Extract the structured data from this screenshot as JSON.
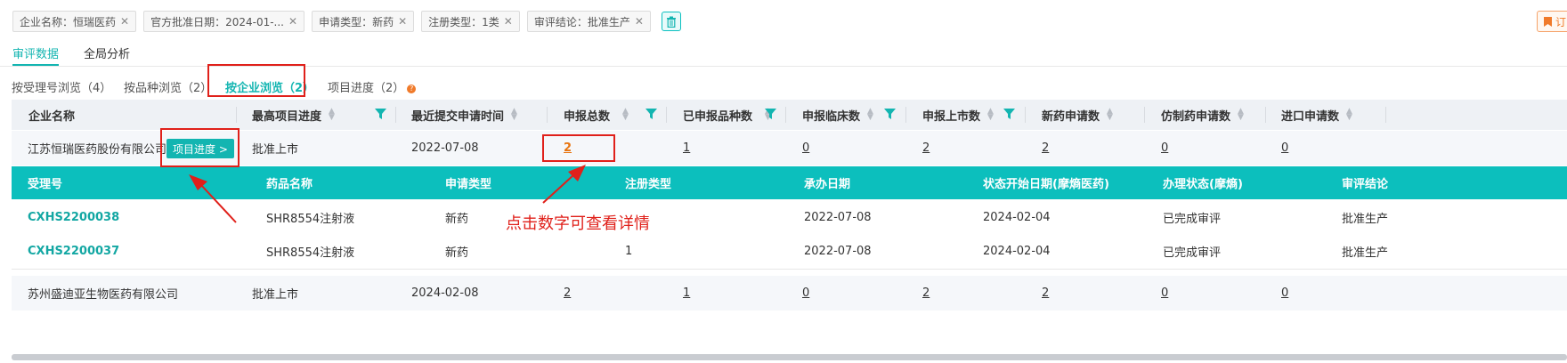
{
  "filters": [
    {
      "label": "企业名称：恒瑞医药"
    },
    {
      "label": "官方批准日期：2024-01-..."
    },
    {
      "label": "申请类型：新药"
    },
    {
      "label": "注册类型：1类"
    },
    {
      "label": "审评结论：批准生产"
    }
  ],
  "subscribe_label": "订",
  "main_tabs": [
    {
      "label": "审评数据"
    },
    {
      "label": "全局分析"
    }
  ],
  "sub_tabs": [
    {
      "label": "按受理号浏览（4）"
    },
    {
      "label": "按品种浏览（2）"
    },
    {
      "label": "按企业浏览（2）"
    },
    {
      "label": "项目进度（2）"
    }
  ],
  "columns": [
    {
      "label": "企业名称"
    },
    {
      "label": "最高项目进度"
    },
    {
      "label": "最近提交申请时间"
    },
    {
      "label": "申报总数"
    },
    {
      "label": "已申报品种数"
    },
    {
      "label": "申报临床数"
    },
    {
      "label": "申报上市数"
    },
    {
      "label": "新药申请数"
    },
    {
      "label": "仿制药申请数"
    },
    {
      "label": "进口申请数"
    }
  ],
  "rows": [
    {
      "company": "江苏恒瑞医药股份有限公司",
      "progress_button": "项目进度 >",
      "highest_progress": "批准上市",
      "latest_date": "2022-07-08",
      "total": "2",
      "varieties": "1",
      "clinical": "0",
      "market": "2",
      "new_drug": "2",
      "generic": "0",
      "import": "0"
    },
    {
      "company": "苏州盛迪亚生物医药有限公司",
      "highest_progress": "批准上市",
      "latest_date": "2024-02-08",
      "total": "2",
      "varieties": "1",
      "clinical": "0",
      "market": "2",
      "new_drug": "2",
      "generic": "0",
      "import": "0"
    }
  ],
  "sub_columns": [
    {
      "label": "受理号"
    },
    {
      "label": "药品名称"
    },
    {
      "label": "申请类型"
    },
    {
      "label": "注册类型"
    },
    {
      "label": "承办日期"
    },
    {
      "label": "状态开始日期(摩熵医药)"
    },
    {
      "label": "办理状态(摩熵)"
    },
    {
      "label": "审评结论"
    }
  ],
  "sub_rows": [
    {
      "accept_no": "CXHS2200038",
      "drug": "SHR8554注射液",
      "app_type": "新药",
      "reg_type": "",
      "host_date": "2022-07-08",
      "status_date": "2024-02-04",
      "status": "已完成审评",
      "conclusion": "批准生产"
    },
    {
      "accept_no": "CXHS2200037",
      "drug": "SHR8554注射液",
      "app_type": "新药",
      "reg_type": "1",
      "host_date": "2022-07-08",
      "status_date": "2024-02-04",
      "status": "已完成审评",
      "conclusion": "批准生产"
    }
  ],
  "annotation": "点击数字可查看详情",
  "colors": {
    "accent": "#13b5b1",
    "teal_header": "#0cbfbd",
    "annotation_red": "#e0201a",
    "orange": "#e8740f"
  }
}
